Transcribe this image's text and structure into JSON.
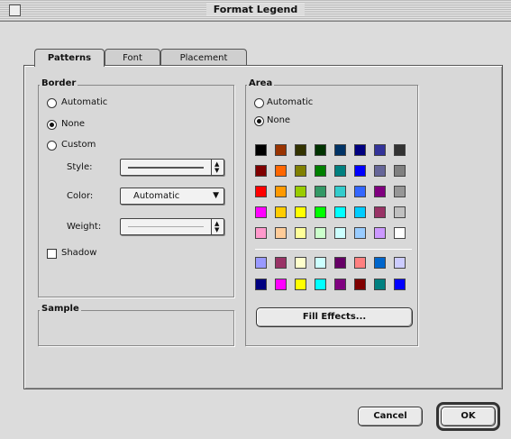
{
  "window": {
    "title": "Format Legend"
  },
  "tabs": [
    {
      "label": "Patterns",
      "active": true
    },
    {
      "label": "Font",
      "active": false
    },
    {
      "label": "Placement",
      "active": false
    }
  ],
  "border": {
    "group_label": "Border",
    "options": [
      {
        "label": "Automatic",
        "selected": false
      },
      {
        "label": "None",
        "selected": true
      },
      {
        "label": "Custom",
        "selected": false
      }
    ],
    "style_label": "Style:",
    "color_label": "Color:",
    "color_value": "Automatic",
    "weight_label": "Weight:",
    "shadow_label": "Shadow",
    "shadow_checked": false
  },
  "sample": {
    "group_label": "Sample"
  },
  "area": {
    "group_label": "Area",
    "options": [
      {
        "label": "Automatic",
        "selected": false
      },
      {
        "label": "None",
        "selected": true
      }
    ],
    "palette_main": [
      [
        "#000000",
        "#993300",
        "#333300",
        "#003300",
        "#003366",
        "#000080",
        "#333399",
        "#333333"
      ],
      [
        "#800000",
        "#FF6600",
        "#808000",
        "#008000",
        "#008080",
        "#0000FF",
        "#666699",
        "#808080"
      ],
      [
        "#FF0000",
        "#FF9900",
        "#99CC00",
        "#339966",
        "#33CCCC",
        "#3366FF",
        "#800080",
        "#969696"
      ],
      [
        "#FF00FF",
        "#FFCC00",
        "#FFFF00",
        "#00FF00",
        "#00FFFF",
        "#00CCFF",
        "#993366",
        "#C0C0C0"
      ],
      [
        "#FF99CC",
        "#FFCC99",
        "#FFFF99",
        "#CCFFCC",
        "#CCFFFF",
        "#99CCFF",
        "#CC99FF",
        "#FFFFFF"
      ]
    ],
    "palette_chart": [
      [
        "#9999FF",
        "#993366",
        "#FFFFCC",
        "#CCFFFF",
        "#660066",
        "#FF8080",
        "#0066CC",
        "#CCCCFF"
      ],
      [
        "#000080",
        "#FF00FF",
        "#FFFF00",
        "#00FFFF",
        "#800080",
        "#800000",
        "#008080",
        "#0000FF"
      ]
    ],
    "fill_effects_label": "Fill Effects..."
  },
  "buttons": {
    "cancel_label": "Cancel",
    "ok_label": "OK"
  }
}
